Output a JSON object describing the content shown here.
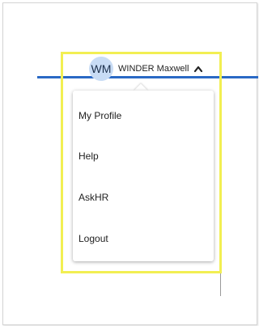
{
  "user": {
    "initials": "WM",
    "name": "WINDER Maxwell",
    "expand_icon": "chevron-up-icon"
  },
  "menu": {
    "items": [
      {
        "label": "My Profile"
      },
      {
        "label": "Help"
      },
      {
        "label": "AskHR"
      },
      {
        "label": "Logout"
      }
    ]
  },
  "colors": {
    "accent": "#2a69c5",
    "highlight": "#f2ef52",
    "avatar_bg": "#c8dcf5"
  }
}
